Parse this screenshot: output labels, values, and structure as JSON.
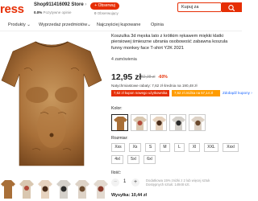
{
  "header": {
    "logo_text": "ress",
    "store_name": "Shop911416092 Store",
    "store_chevron": "›",
    "store_positive_rating": "0.0%",
    "store_positive_label": "Pozytywne opinie",
    "follow_button": "+ Obserwuj",
    "followers_count": "0",
    "followers_label": "Obserwujący",
    "search_value": "Kupuj za",
    "search_icon": "search-icon"
  },
  "nav": {
    "items": [
      "Produkty ⌄",
      "Wyprzedaż przedmiotów⌄",
      "Najczęściej kupowane",
      "Opinia"
    ]
  },
  "product": {
    "title": "Koszulka 3d męska lato z krótkim rękawem miękki klatki piersiowej śmieszne ubrania osobowość zabawna koszula funny monkey face T-shirt Y2K 2021",
    "orders": "4 zamówienia",
    "price": "12,95 zł",
    "old_price": "32,38 zł",
    "discount": "-60%",
    "instant_discount": "Natychmiastowe rabaty: 7,62 zł średnia na 190,48 zł",
    "coupon_1": "7,62 zł kupon nowego użytkownika",
    "coupon_2": "7,62 zł zniżka na 57,14 zł",
    "more_coupons": "Zdobądź kupony ›"
  },
  "options": {
    "color_label": "Kolor:",
    "size_label": "Rozmiar:",
    "sizes_row_1": [
      "Xxs",
      "Xs",
      "S",
      "M",
      "L",
      "Xl",
      "XXL",
      "Xxxl",
      "4xl",
      "5xl"
    ],
    "sizes_row_2": [
      "6xl"
    ],
    "quantity_label": "Ilość:",
    "quantity_value": "1",
    "minus": "−",
    "plus": "+",
    "ship_info_1": "Dodatkowa 15% zniżki z 2 lub więcej sztuk",
    "ship_info_2": "Dostępnych sztuk: 14948 szt.",
    "shipping": "Wysyłka: 10,44 zł"
  },
  "colors": {
    "accent": "#e62e04",
    "coupon_orange": "#ff9c00",
    "link_blue": "#1a66ff"
  }
}
